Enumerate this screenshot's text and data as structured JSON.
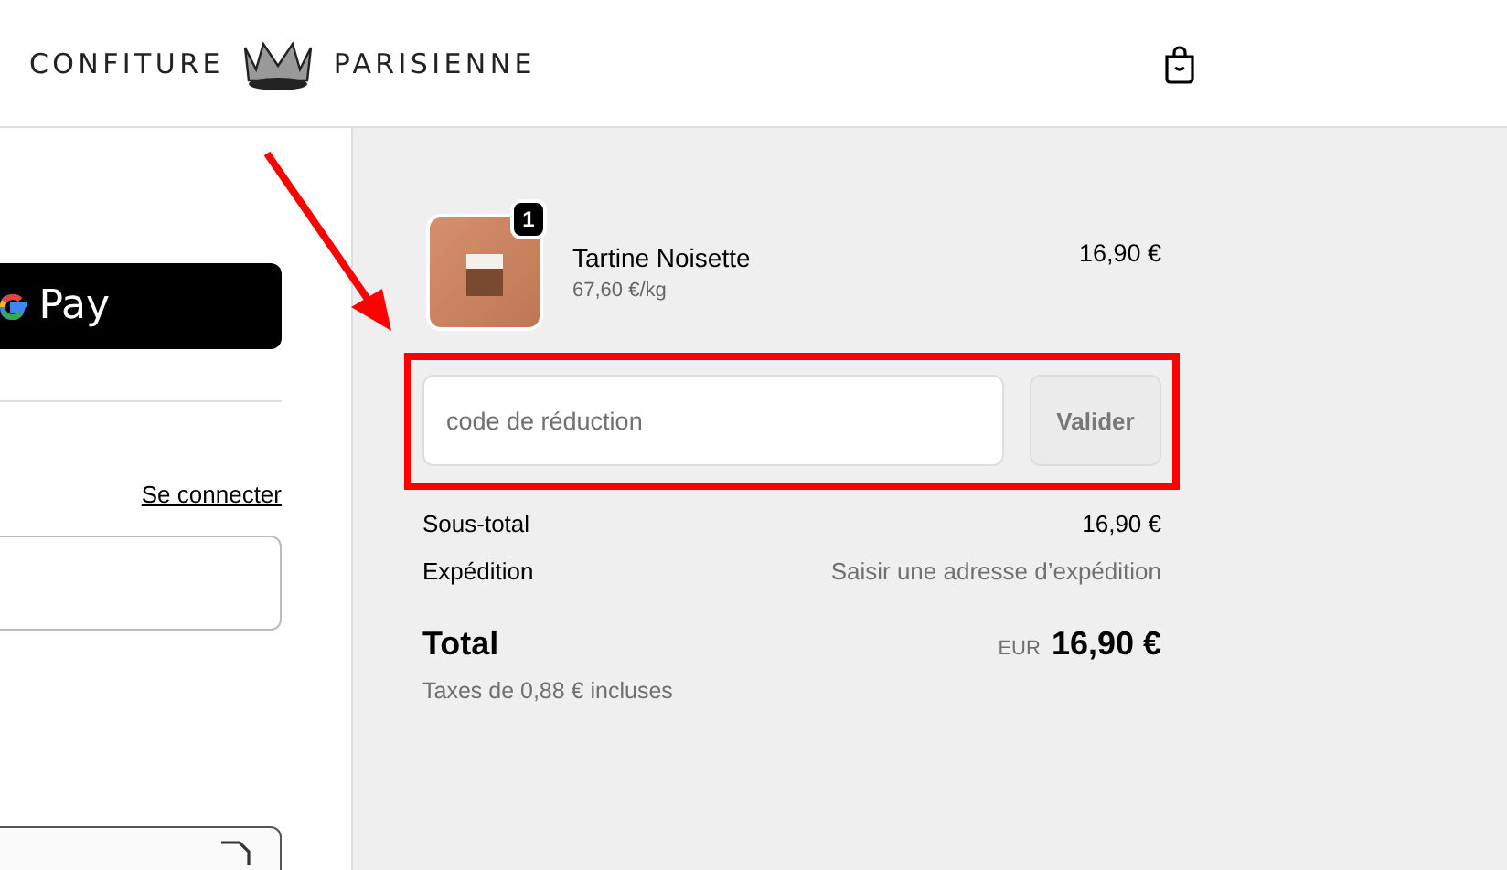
{
  "header": {
    "brand_left": "CONFITURE",
    "brand_right": "PARISIENNE"
  },
  "left": {
    "pay_button": {
      "label": "Pay"
    },
    "login_link": "Se connecter"
  },
  "order": {
    "item": {
      "name": "Tartine Noisette",
      "unit_price": "67,60 €/kg",
      "price": "16,90 €",
      "quantity": "1"
    },
    "discount": {
      "placeholder": "code de réduction",
      "button": "Valider",
      "disabled": true
    },
    "summary": [
      {
        "label": "Sous-total",
        "value": "16,90 €",
        "kind": "amount"
      },
      {
        "label": "Expédition",
        "value": "Saisir une adresse d’expédition",
        "kind": "hint"
      }
    ],
    "total": {
      "label": "Total",
      "currency": "EUR",
      "amount": "16,90 €"
    },
    "taxes": "Taxes de 0,88 € incluses"
  }
}
